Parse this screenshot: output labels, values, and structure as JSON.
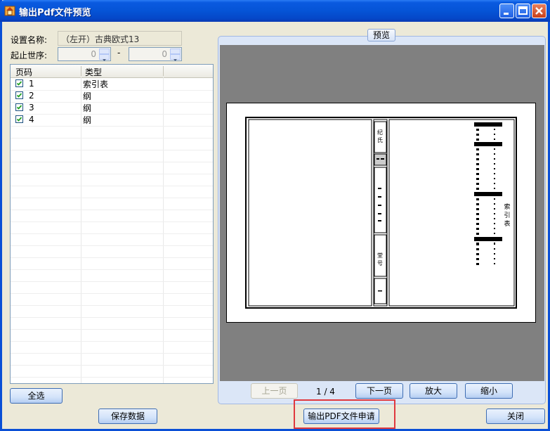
{
  "window": {
    "title": "输出Pdf文件预览"
  },
  "settings": {
    "name_label": "设置名称:",
    "name_value": "（左开）古典欧式13",
    "range_label": "起止世序:",
    "range_from": "0",
    "range_dash": "-",
    "range_to": "0"
  },
  "grid": {
    "headers": {
      "page": "页码",
      "type": "类型"
    },
    "rows": [
      {
        "checked": true,
        "page": "1",
        "type": "索引表"
      },
      {
        "checked": true,
        "page": "2",
        "type": "纲"
      },
      {
        "checked": true,
        "page": "3",
        "type": "纲"
      },
      {
        "checked": true,
        "page": "4",
        "type": "纲"
      }
    ]
  },
  "preview": {
    "legend": "预览",
    "page_indicator": "1 / 4",
    "prev_label": "上一页",
    "next_label": "下一页",
    "zoom_in_label": "放大",
    "zoom_out_label": "缩小",
    "document_labels": {
      "title": "索引表",
      "year": "纪氏",
      "volume": "堂号"
    }
  },
  "buttons": {
    "select_all": "全选",
    "save": "保存数据",
    "export": "输出PDF文件申请",
    "close": "关闭"
  },
  "colors": {
    "titlebar": "#0554d6",
    "highlight": "#e0383e",
    "preview_bg": "#808080"
  }
}
